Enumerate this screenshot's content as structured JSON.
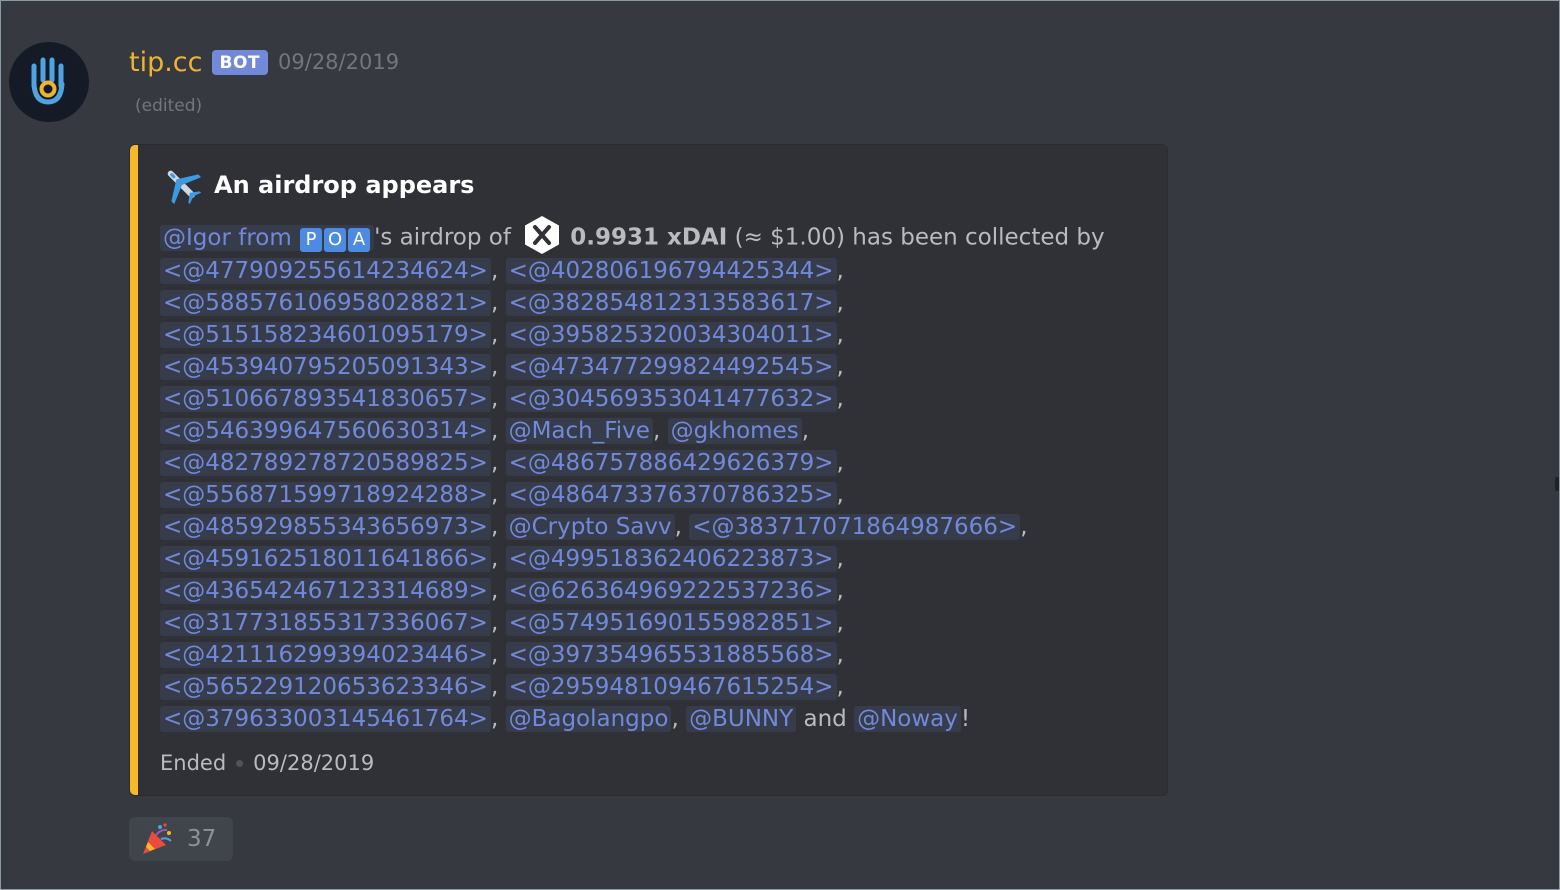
{
  "message": {
    "username": "tip.cc",
    "bot_tag": "BOT",
    "timestamp": "09/28/2019",
    "edited": "(edited)",
    "avatar_icon": "hand-icon"
  },
  "embed": {
    "accent_color": "#f7b92b",
    "title_icon": "airplane-icon",
    "title": "An airdrop appears",
    "intro": {
      "mention": "@Igor from",
      "letters": [
        "P",
        "O",
        "A"
      ],
      "text_after_mention": "'s airdrop of",
      "token_icon": "xdai-icon",
      "amount": "0.9931 xDAI",
      "value": "(≈ $1.00) has been collected by"
    },
    "collectors": [
      [
        "<@477909255614234624>",
        "<@402806196794425344>"
      ],
      [
        "<@588576106958028821>",
        "<@382854812313583617>"
      ],
      [
        "<@515158234601095179>",
        "<@395825320034304011>"
      ],
      [
        "<@453940795205091343>",
        "<@473477299824492545>"
      ],
      [
        "<@510667893541830657>",
        "<@304569353041477632>"
      ],
      [
        "<@546399647560630314>",
        "@Mach_Five",
        "@gkhomes"
      ],
      [
        "<@482789278720589825>",
        "<@486757886429626379>"
      ],
      [
        "<@556871599718924288>",
        "<@486473376370786325>"
      ],
      [
        "<@485929855343656973>",
        "@Crypto Savv",
        "<@383717071864987666>"
      ],
      [
        "<@459162518011641866>",
        "<@499518362406223873>"
      ],
      [
        "<@436542467123314689>",
        "<@626364969222537236>"
      ],
      [
        "<@317731855317336067>",
        "<@574951690155982851>"
      ],
      [
        "<@421116299394023446>",
        "<@397354965531885568>"
      ],
      [
        "<@565229120653623346>",
        "<@295948109467615254>"
      ],
      [
        "<@379633003145461764>",
        "@Bagolangpo",
        "@BUNNY"
      ]
    ],
    "and_word": "and",
    "last_collector": "@Noway",
    "end_punct": "!",
    "footer_status": "Ended",
    "footer_date": "09/28/2019"
  },
  "reaction": {
    "icon": "party-popper-icon",
    "count": "37"
  }
}
